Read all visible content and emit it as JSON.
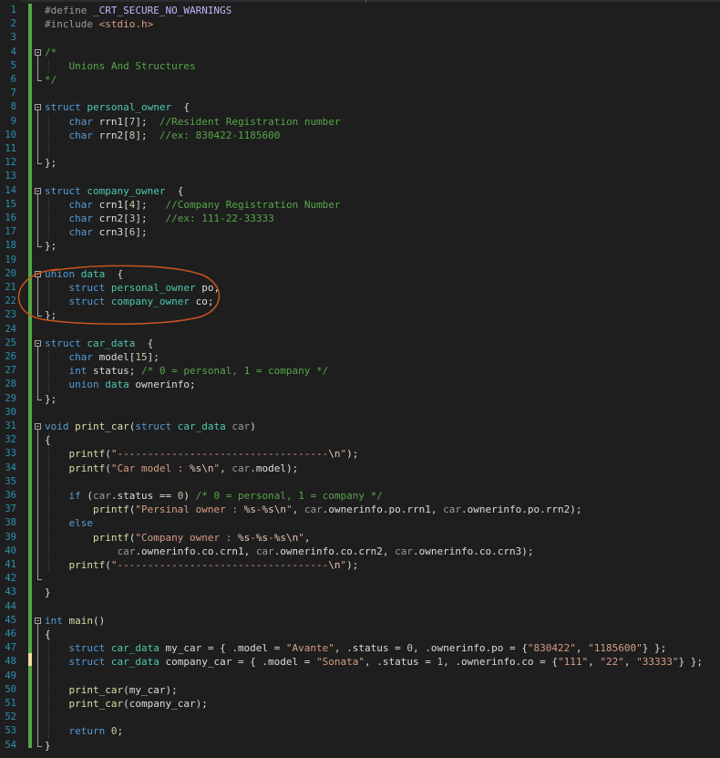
{
  "editor": {
    "line_numbers": [
      "1",
      "2",
      "3",
      "4",
      "5",
      "6",
      "7",
      "8",
      "9",
      "10",
      "11",
      "12",
      "13",
      "14",
      "15",
      "16",
      "17",
      "18",
      "19",
      "20",
      "21",
      "22",
      "23",
      "24",
      "25",
      "26",
      "27",
      "28",
      "29",
      "30",
      "31",
      "32",
      "33",
      "34",
      "35",
      "36",
      "37",
      "38",
      "39",
      "40",
      "41",
      "42",
      "43",
      "44",
      "45",
      "46",
      "47",
      "48",
      "49",
      "50",
      "51",
      "52",
      "53",
      "54"
    ],
    "colors": {
      "background": "#1e1e1e",
      "line_number": "#2b91af",
      "keyword": "#569cd6",
      "type": "#4ec9b0",
      "string": "#d69d85",
      "comment": "#57a64a",
      "number": "#b5cea8",
      "function": "#dcdcaa",
      "highlight_ring": "#c8541e",
      "change_bar": "#57a64a"
    },
    "annotation": "orange-hand-drawn-circle-around-union-data",
    "lines": [
      [
        [
          "pp",
          "#define "
        ],
        [
          "mc",
          "_CRT_SECURE_NO_WARNINGS"
        ]
      ],
      [
        [
          "pp",
          "#include "
        ],
        [
          "st",
          "<stdio.h>"
        ]
      ],
      [],
      [
        [
          "cm",
          "/*"
        ]
      ],
      [
        [
          "cm",
          "    Unions And Structures"
        ]
      ],
      [
        [
          "cm",
          "*/"
        ]
      ],
      [],
      [
        [
          "kw",
          "struct "
        ],
        [
          "ty",
          "personal_owner"
        ],
        [
          "",
          "  {"
        ]
      ],
      [
        [
          "",
          "    "
        ],
        [
          "kw",
          "char "
        ],
        [
          "",
          "rrn1["
        ],
        [
          "nu",
          "7"
        ],
        [
          "",
          "];  "
        ],
        [
          "cm",
          "//Resident Registration number"
        ]
      ],
      [
        [
          "",
          "    "
        ],
        [
          "kw",
          "char "
        ],
        [
          "",
          "rrn2["
        ],
        [
          "nu",
          "8"
        ],
        [
          "",
          "];  "
        ],
        [
          "cm",
          "//ex: 830422-1185600"
        ]
      ],
      [],
      [
        [
          "",
          "};"
        ]
      ],
      [],
      [
        [
          "kw",
          "struct "
        ],
        [
          "ty",
          "company_owner"
        ],
        [
          "",
          "  {"
        ]
      ],
      [
        [
          "",
          "    "
        ],
        [
          "kw",
          "char "
        ],
        [
          "",
          "crn1["
        ],
        [
          "nu",
          "4"
        ],
        [
          "",
          "];   "
        ],
        [
          "cm",
          "//Company Registration Number"
        ]
      ],
      [
        [
          "",
          "    "
        ],
        [
          "kw",
          "char "
        ],
        [
          "",
          "crn2["
        ],
        [
          "nu",
          "3"
        ],
        [
          "",
          "];   "
        ],
        [
          "cm",
          "//ex: 111-22-33333"
        ]
      ],
      [
        [
          "",
          "    "
        ],
        [
          "kw",
          "char "
        ],
        [
          "",
          "crn3["
        ],
        [
          "nu",
          "6"
        ],
        [
          "",
          "];"
        ]
      ],
      [
        [
          "",
          "};"
        ]
      ],
      [],
      [
        [
          "kw",
          "union "
        ],
        [
          "ty",
          "data"
        ],
        [
          "",
          "  {"
        ]
      ],
      [
        [
          "",
          "    "
        ],
        [
          "kw",
          "struct "
        ],
        [
          "ty",
          "personal_owner "
        ],
        [
          "",
          "po;"
        ]
      ],
      [
        [
          "",
          "    "
        ],
        [
          "kw",
          "struct "
        ],
        [
          "ty",
          "company_owner "
        ],
        [
          "",
          "co;"
        ]
      ],
      [
        [
          "",
          "};"
        ]
      ],
      [],
      [
        [
          "kw",
          "struct "
        ],
        [
          "ty",
          "car_data"
        ],
        [
          "",
          "  {"
        ]
      ],
      [
        [
          "",
          "    "
        ],
        [
          "kw",
          "char "
        ],
        [
          "",
          "model["
        ],
        [
          "nu",
          "15"
        ],
        [
          "",
          "];"
        ]
      ],
      [
        [
          "",
          "    "
        ],
        [
          "kw",
          "int "
        ],
        [
          "",
          "status; "
        ],
        [
          "cm",
          "/* 0 = personal, 1 = company */"
        ]
      ],
      [
        [
          "",
          "    "
        ],
        [
          "kw",
          "union "
        ],
        [
          "ty",
          "data "
        ],
        [
          "",
          "ownerinfo;"
        ]
      ],
      [
        [
          "",
          "};"
        ]
      ],
      [],
      [
        [
          "kw",
          "void "
        ],
        [
          "fn",
          "print_car"
        ],
        [
          "",
          "("
        ],
        [
          "kw",
          "struct "
        ],
        [
          "ty",
          "car_data "
        ],
        [
          "pa",
          "car"
        ],
        [
          "",
          ")"
        ]
      ],
      [
        [
          "",
          "{"
        ]
      ],
      [
        [
          "",
          "    "
        ],
        [
          "fn",
          "printf"
        ],
        [
          "",
          "("
        ],
        [
          "st",
          "\"-----------------------------------"
        ],
        [
          "es",
          "\\n"
        ],
        [
          "st",
          "\""
        ],
        [
          "",
          ");"
        ]
      ],
      [
        [
          "",
          "    "
        ],
        [
          "fn",
          "printf"
        ],
        [
          "",
          "("
        ],
        [
          "st",
          "\"Car model : "
        ],
        [
          "es",
          "%s\\n"
        ],
        [
          "st",
          "\""
        ],
        [
          "",
          ", "
        ],
        [
          "pa",
          "car"
        ],
        [
          "",
          ".model);"
        ]
      ],
      [],
      [
        [
          "",
          "    "
        ],
        [
          "kw",
          "if "
        ],
        [
          "",
          "("
        ],
        [
          "pa",
          "car"
        ],
        [
          "",
          ".status == "
        ],
        [
          "nu",
          "0"
        ],
        [
          "",
          ") "
        ],
        [
          "cm",
          "/* 0 = personal, 1 = company */"
        ]
      ],
      [
        [
          "",
          "        "
        ],
        [
          "fn",
          "printf"
        ],
        [
          "",
          "("
        ],
        [
          "st",
          "\"Persinal owner : "
        ],
        [
          "es",
          "%s"
        ],
        [
          "st",
          "-"
        ],
        [
          "es",
          "%s\\n"
        ],
        [
          "st",
          "\""
        ],
        [
          "",
          ", "
        ],
        [
          "pa",
          "car"
        ],
        [
          "",
          ".ownerinfo.po.rrn1, "
        ],
        [
          "pa",
          "car"
        ],
        [
          "",
          ".ownerinfo.po.rrn2);"
        ]
      ],
      [
        [
          "",
          "    "
        ],
        [
          "kw",
          "else"
        ]
      ],
      [
        [
          "",
          "        "
        ],
        [
          "fn",
          "printf"
        ],
        [
          "",
          "("
        ],
        [
          "st",
          "\"Company owner : "
        ],
        [
          "es",
          "%s"
        ],
        [
          "st",
          "-"
        ],
        [
          "es",
          "%s"
        ],
        [
          "st",
          "-"
        ],
        [
          "es",
          "%s\\n"
        ],
        [
          "st",
          "\""
        ],
        [
          "",
          ","
        ]
      ],
      [
        [
          "",
          "            "
        ],
        [
          "pa",
          "car"
        ],
        [
          "",
          ".ownerinfo.co.crn1, "
        ],
        [
          "pa",
          "car"
        ],
        [
          "",
          ".ownerinfo.co.crn2, "
        ],
        [
          "pa",
          "car"
        ],
        [
          "",
          ".ownerinfo.co.crn3);"
        ]
      ],
      [
        [
          "",
          "    "
        ],
        [
          "fn",
          "printf"
        ],
        [
          "",
          "("
        ],
        [
          "st",
          "\"-----------------------------------"
        ],
        [
          "es",
          "\\n"
        ],
        [
          "st",
          "\""
        ],
        [
          "",
          ");"
        ]
      ],
      [],
      [
        [
          "",
          "}"
        ]
      ],
      [],
      [
        [
          "kw",
          "int "
        ],
        [
          "fn",
          "main"
        ],
        [
          "",
          "()"
        ]
      ],
      [
        [
          "",
          "{"
        ]
      ],
      [
        [
          "",
          "    "
        ],
        [
          "kw",
          "struct "
        ],
        [
          "ty",
          "car_data "
        ],
        [
          "",
          "my_car = { .model = "
        ],
        [
          "st",
          "\"Avante\""
        ],
        [
          "",
          ", .status = "
        ],
        [
          "nu",
          "0"
        ],
        [
          "",
          ", .ownerinfo.po = {"
        ],
        [
          "st",
          "\"830422\""
        ],
        [
          "",
          ", "
        ],
        [
          "st",
          "\"1185600\""
        ],
        [
          "",
          "} };"
        ]
      ],
      [
        [
          "",
          "    "
        ],
        [
          "kw",
          "struct "
        ],
        [
          "ty",
          "car_data "
        ],
        [
          "",
          "company_car = { .model = "
        ],
        [
          "st",
          "\"Sonata\""
        ],
        [
          "",
          ", .status = "
        ],
        [
          "nu",
          "1"
        ],
        [
          "",
          ", .ownerinfo.co = {"
        ],
        [
          "st",
          "\"111\""
        ],
        [
          "",
          ", "
        ],
        [
          "st",
          "\"22\""
        ],
        [
          "",
          ", "
        ],
        [
          "st",
          "\"33333\""
        ],
        [
          "",
          "} };"
        ]
      ],
      [],
      [
        [
          "",
          "    "
        ],
        [
          "fn",
          "print_car"
        ],
        [
          "",
          "(my_car);"
        ]
      ],
      [
        [
          "",
          "    "
        ],
        [
          "fn",
          "print_car"
        ],
        [
          "",
          "(company_car);"
        ]
      ],
      [],
      [
        [
          "",
          "    "
        ],
        [
          "kw",
          "return "
        ],
        [
          "nu",
          "0"
        ],
        [
          "",
          ";"
        ]
      ],
      [
        [
          "",
          "}"
        ]
      ]
    ]
  }
}
